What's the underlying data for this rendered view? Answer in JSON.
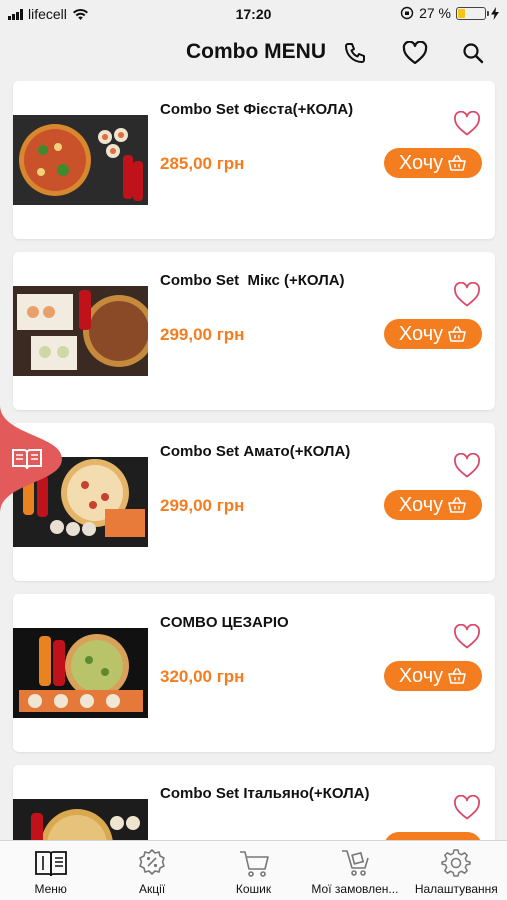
{
  "status": {
    "carrier": "lifecell",
    "time": "17:20",
    "battery": "27 %",
    "battery_level": 0.27
  },
  "header": {
    "title": "Combo MENU"
  },
  "colors": {
    "accent": "#f47d20",
    "heart": "#d94a6a",
    "side_tab": "#e35a5a"
  },
  "products": [
    {
      "name": "Combo Set Фієста(+КОЛА)",
      "price": "285,00 грн",
      "button": "Хочу"
    },
    {
      "name": "Combo Set  Мікс (+КОЛА)",
      "price": "299,00 грн",
      "button": "Хочу"
    },
    {
      "name": "Combo Set Амато(+КОЛА)",
      "price": "299,00 грн",
      "button": "Хочу"
    },
    {
      "name": "COMBO ЦЕЗАРІО",
      "price": "320,00 грн",
      "button": "Хочу"
    },
    {
      "name": "Combo Set Італьяно(+КОЛА)",
      "price": "",
      "button": ""
    }
  ],
  "tabbar": {
    "items": [
      {
        "label": "Меню",
        "icon": "menu-book-icon"
      },
      {
        "label": "Акції",
        "icon": "discount-icon"
      },
      {
        "label": "Кошик",
        "icon": "cart-icon"
      },
      {
        "label": "Мої замовлен...",
        "icon": "orders-cart-icon"
      },
      {
        "label": "Налаштування",
        "icon": "gear-icon"
      }
    ]
  }
}
